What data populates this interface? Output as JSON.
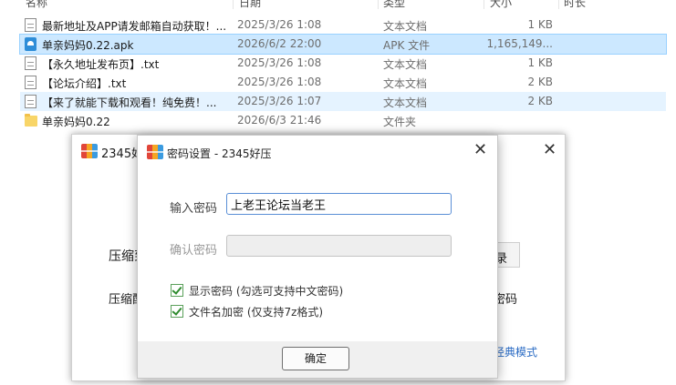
{
  "file_list": {
    "headers": {
      "name": "名称",
      "date": "日期",
      "type": "类型",
      "size": "大小",
      "duration": "时长"
    },
    "rows": [
      {
        "icon": "text-file-icon",
        "name": "最新地址及APP请发邮箱自动获取！...",
        "date": "2025/3/26 1:08",
        "type": "文本文档",
        "size": "1 KB"
      },
      {
        "icon": "apk-file-icon",
        "name": "单亲妈妈0.22.apk",
        "date": "2026/6/2 22:00",
        "type": "APK 文件",
        "size": "1,165,149..."
      },
      {
        "icon": "text-file-icon",
        "name": "【永久地址发布页】.txt",
        "date": "2025/3/26 1:08",
        "type": "文本文档",
        "size": "1 KB"
      },
      {
        "icon": "text-file-icon",
        "name": "【论坛介绍】.txt",
        "date": "2025/3/26 1:08",
        "type": "文本文档",
        "size": "2 KB"
      },
      {
        "icon": "text-file-icon",
        "name": "【来了就能下载和观看！纯免费！...",
        "date": "2025/3/26 1:07",
        "type": "文本文档",
        "size": "2 KB"
      },
      {
        "icon": "folder-icon",
        "name": "单亲妈妈0.22",
        "date": "2026/6/3 21:46",
        "type": "文件夹",
        "size": ""
      }
    ]
  },
  "back_dialog": {
    "title": "2345好",
    "label1": "压缩到",
    "label2": "压缩配",
    "button_text": "录",
    "side_text": "密码",
    "link": "经典模式"
  },
  "password_dialog": {
    "title": "密码设置 - 2345好压",
    "password_label": "输入密码",
    "password_value": "上老王论坛当老王",
    "confirm_label": "确认密码",
    "confirm_value": "",
    "show_password_label": "显示密码 (勾选可支持中文密码)",
    "show_password_checked": true,
    "encrypt_names_label": "文件名加密  (仅支持7z格式)",
    "encrypt_names_checked": true,
    "ok_button": "确定"
  },
  "colors": {
    "selection": "#cce8ff",
    "hover": "#e5f3ff",
    "input_border": "#5a8fd6",
    "checkbox": "#2e8b2e",
    "link": "#2a6bc4"
  }
}
